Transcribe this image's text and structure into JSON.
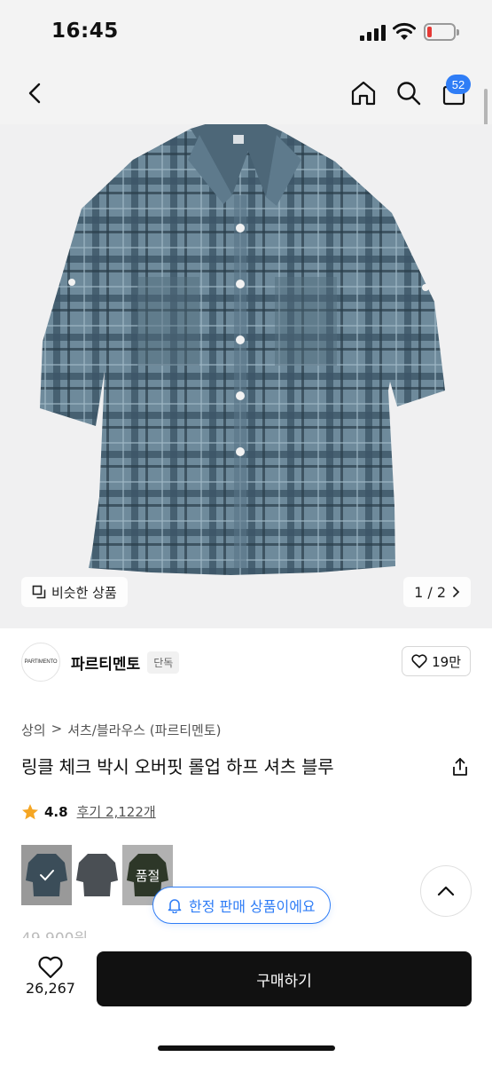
{
  "status": {
    "time": "16:45"
  },
  "header": {
    "cart_count": "52"
  },
  "gallery": {
    "similar_label": "비슷한 상품",
    "page_indicator": "1 / 2",
    "shirt_color": "#5b7789"
  },
  "brand": {
    "logo_text": "PARTIMENTO",
    "name": "파르티멘토",
    "tag": "단독",
    "like_count": "19만"
  },
  "breadcrumb": {
    "items": [
      "상의",
      "셔츠/블라우스 (파르티멘토)"
    ],
    "separator": ">"
  },
  "product": {
    "title": "링클 체크 박시 오버핏 롤업 하프 셔츠 블루",
    "rating": "4.8",
    "review_label": "후기 2,122개",
    "price_partial": "49,900원"
  },
  "options": {
    "sold_out_label": "품절"
  },
  "notice": {
    "limited_label": "한정 판매 상품이에요"
  },
  "bottom": {
    "wish_count": "26,267",
    "buy_label": "구매하기"
  },
  "colors": {
    "accent": "#2f7df6",
    "star": "#f5a623",
    "buy_button": "#111111"
  }
}
